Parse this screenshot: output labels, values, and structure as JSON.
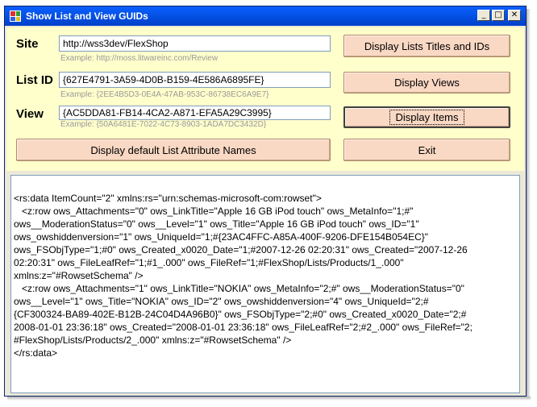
{
  "window": {
    "title": "Show List and View GUIDs",
    "controls": {
      "minimize": "_",
      "maximize": "□",
      "close": "✕"
    }
  },
  "form": {
    "site": {
      "label": "Site",
      "value": "http://wss3dev/FlexShop",
      "example": "Example: http://moss.litwareinc.com/Review"
    },
    "list_id": {
      "label": "List ID",
      "value": "{627E4791-3A59-4D0B-B159-4E586A6895FE}",
      "example": "Example: {2EE4B5D3-0E4A-47AB-953C-86738EC6A9E7}"
    },
    "view": {
      "label": "View",
      "value": "{AC5DDA81-FB14-4CA2-A871-EFA5A29C3995}",
      "example": "Example: {50A6481E-7022-4C73-8903-1ADA7DC3432D}"
    }
  },
  "buttons": {
    "display_lists": "Display Lists Titles and IDs",
    "display_views": "Display Views",
    "display_items": "Display Items",
    "display_default_attrs": "Display default List Attribute Names",
    "exit": "Exit"
  },
  "output": {
    "text": "<rs:data ItemCount=\"2\" xmlns:rs=\"urn:schemas-microsoft-com:rowset\">\n   <z:row ows_Attachments=\"0\" ows_LinkTitle=\"Apple 16 GB iPod touch\" ows_MetaInfo=\"1;#\"\nows__ModerationStatus=\"0\" ows__Level=\"1\" ows_Title=\"Apple 16 GB iPod touch\" ows_ID=\"1\"\nows_owshiddenversion=\"1\" ows_UniqueId=\"1;#{23AC4FFC-A85A-400F-9206-DFE154B054EC}\"\nows_FSObjType=\"1;#0\" ows_Created_x0020_Date=\"1;#2007-12-26 02:20:31\" ows_Created=\"2007-12-26\n02:20:31\" ows_FileLeafRef=\"1;#1_.000\" ows_FileRef=\"1;#FlexShop/Lists/Products/1_.000\"\nxmlns:z=\"#RowsetSchema\" />\n   <z:row ows_Attachments=\"1\" ows_LinkTitle=\"NOKIA\" ows_MetaInfo=\"2;#\" ows__ModerationStatus=\"0\"\nows__Level=\"1\" ows_Title=\"NOKIA\" ows_ID=\"2\" ows_owshiddenversion=\"4\" ows_UniqueId=\"2;#\n{CF300324-BA89-402E-B12B-24C04D4A96B0}\" ows_FSObjType=\"2;#0\" ows_Created_x0020_Date=\"2;#\n2008-01-01 23:36:18\" ows_Created=\"2008-01-01 23:36:18\" ows_FileLeafRef=\"2;#2_.000\" ows_FileRef=\"2;\n#FlexShop/Lists/Products/2_.000\" xmlns:z=\"#RowsetSchema\" />\n</rs:data>"
  }
}
